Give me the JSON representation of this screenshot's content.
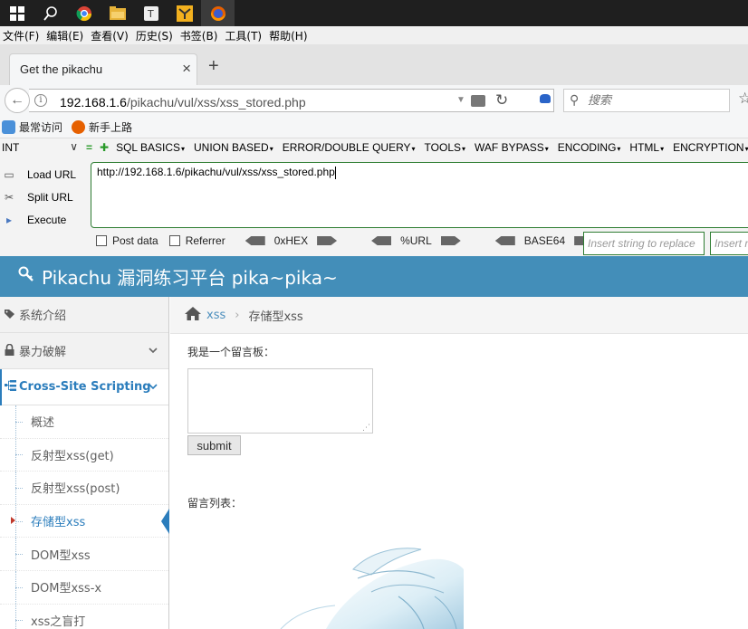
{
  "menubar": [
    "文件(F)",
    "编辑(E)",
    "查看(V)",
    "历史(S)",
    "书签(B)",
    "工具(T)",
    "帮助(H)"
  ],
  "tab": {
    "title": "Get the pikachu"
  },
  "nav": {
    "url_host": "192.168.1.6",
    "url_path": "/pikachu/vul/xss/xss_stored.php",
    "search_placeholder": "搜索"
  },
  "bookmarks": [
    "最常访问",
    "新手上路"
  ],
  "hackbar": {
    "select_value": "INT",
    "menus": [
      "SQL BASICS",
      "UNION BASED",
      "ERROR/DOUBLE QUERY",
      "TOOLS",
      "WAF BYPASS",
      "ENCODING",
      "HTML",
      "ENCRYPTION"
    ],
    "actions": [
      "Load URL",
      "Split URL",
      "Execute"
    ],
    "url_value": "http://192.168.1.6/pikachu/vul/xss/xss_stored.php",
    "post_data": "Post data",
    "referrer": "Referrer",
    "hex": "0xHEX",
    "urlenc": "%URL",
    "base64": "BASE64",
    "replace_placeholder": "Insert string to replace",
    "replace2_placeholder": "Insert r"
  },
  "header": {
    "title": "Pikachu 漏洞练习平台 pika~pika~"
  },
  "sidebar": {
    "items": [
      {
        "label": "系统介绍",
        "icon": "tags-icon"
      },
      {
        "label": "暴力破解",
        "icon": "lock-icon"
      },
      {
        "label": "Cross-Site Scripting",
        "icon": "sitemap-icon"
      }
    ],
    "sub": [
      "概述",
      "反射型xss(get)",
      "反射型xss(post)",
      "存储型xss",
      "DOM型xss",
      "DOM型xss-x",
      "xss之盲打"
    ]
  },
  "breadcrumb": {
    "link": "xss",
    "current": "存储型xss"
  },
  "main": {
    "board_label": "我是一个留言板：",
    "submit": "submit",
    "list_label": "留言列表："
  },
  "colors": {
    "header": "#438eb9",
    "accent": "#2b7dbc",
    "hackbar_border": "#2e7d32"
  }
}
